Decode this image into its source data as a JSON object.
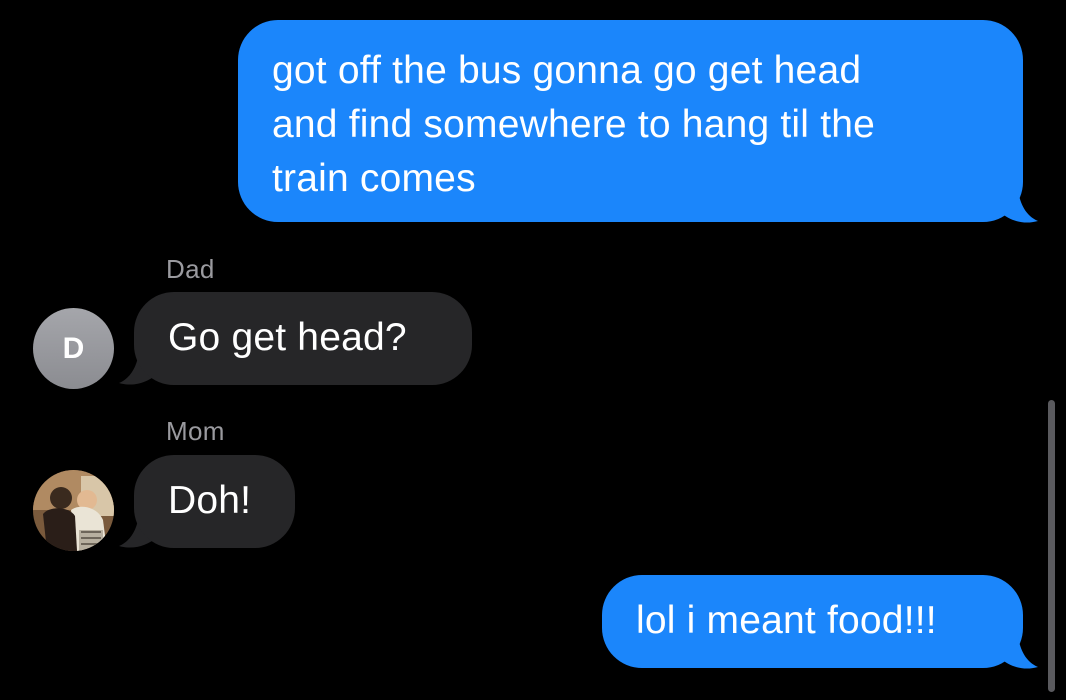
{
  "conversation": {
    "messages": [
      {
        "direction": "outgoing",
        "lines": [
          "got off the bus gonna go get head",
          "and find somewhere to hang til the",
          "train comes"
        ]
      },
      {
        "direction": "incoming",
        "sender": "Dad",
        "avatar_initial": "D",
        "text": "Go get head?"
      },
      {
        "direction": "incoming",
        "sender": "Mom",
        "avatar": "photo-avatar",
        "text": "Doh!"
      },
      {
        "direction": "outgoing",
        "text": "lol i meant food!!!"
      }
    ]
  },
  "colors": {
    "background": "#000000",
    "sent_bubble": "#1b86fb",
    "received_bubble": "#262628",
    "sender_name": "#9a9a9f",
    "avatar_gray": "#9c9da2"
  },
  "icons": {
    "avatar_dad": "initial-avatar",
    "avatar_mom": "photo-avatar"
  }
}
